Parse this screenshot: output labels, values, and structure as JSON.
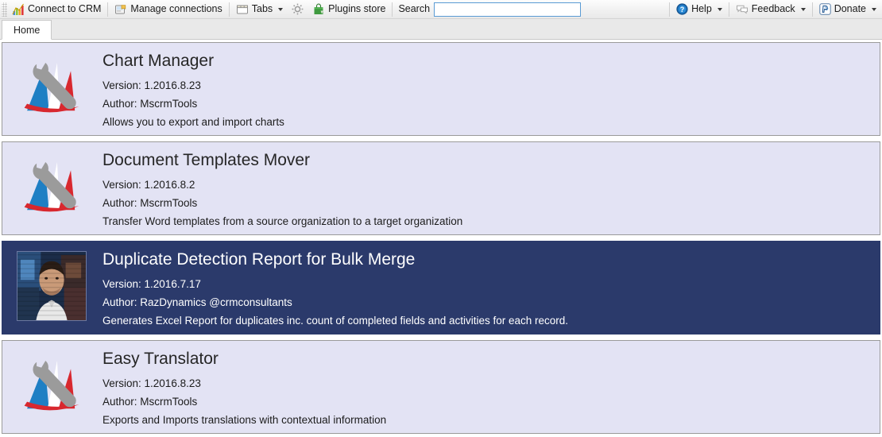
{
  "toolbar": {
    "items": [
      {
        "label": "Connect to CRM",
        "icon": "chart-bars-icon",
        "caret": false
      },
      {
        "label": "Manage connections",
        "icon": "manage-connections-icon",
        "caret": false
      },
      {
        "label": "Tabs",
        "icon": "window-tabs-icon",
        "caret": true
      },
      {
        "label": "",
        "icon": "gear-icon",
        "caret": false
      },
      {
        "label": "Plugins store",
        "icon": "shopping-bag-icon",
        "caret": false
      }
    ],
    "search": {
      "label": "Search",
      "value": "",
      "placeholder": ""
    },
    "right_items": [
      {
        "label": "Help",
        "icon": "help-circle-icon",
        "caret": true
      },
      {
        "label": "Feedback",
        "icon": "speech-bubbles-icon",
        "caret": true
      },
      {
        "label": "Donate",
        "icon": "paypal-icon",
        "caret": true
      }
    ]
  },
  "tabs": [
    {
      "label": "Home",
      "active": true
    }
  ],
  "labels": {
    "version_prefix": "Version: ",
    "author_prefix": "Author: "
  },
  "plugins": [
    {
      "title": "Chart Manager",
      "version_line": "Version: 1.2016.8.23",
      "author_line": "Author: MscrmTools",
      "description": "Allows you to export and import charts",
      "icon": "mscrmtools-wrench-flag-icon",
      "selected": false
    },
    {
      "title": "Document Templates Mover",
      "version_line": "Version: 1.2016.8.2",
      "author_line": "Author: MscrmTools",
      "description": "Transfer Word templates from a source organization to a target organization",
      "icon": "mscrmtools-wrench-flag-icon",
      "selected": false
    },
    {
      "title": "Duplicate Detection Report for Bulk Merge",
      "version_line": "Version: 1.2016.7.17",
      "author_line": "Author: RazDynamics @crmconsultants",
      "description": "Generates Excel Report for duplicates inc. count of completed fields and activities for each record.",
      "icon": "author-photo-avatar",
      "selected": true
    },
    {
      "title": "Easy Translator",
      "version_line": "Version: 1.2016.8.23",
      "author_line": "Author: MscrmTools",
      "description": "Exports and Imports translations with contextual information",
      "icon": "mscrmtools-wrench-flag-icon",
      "selected": false
    }
  ],
  "colors": {
    "selected_background": "#2b3a6b",
    "card_background": "#e3e3f4",
    "card_border": "#9a9a9a",
    "search_border": "#5a9bd4"
  }
}
